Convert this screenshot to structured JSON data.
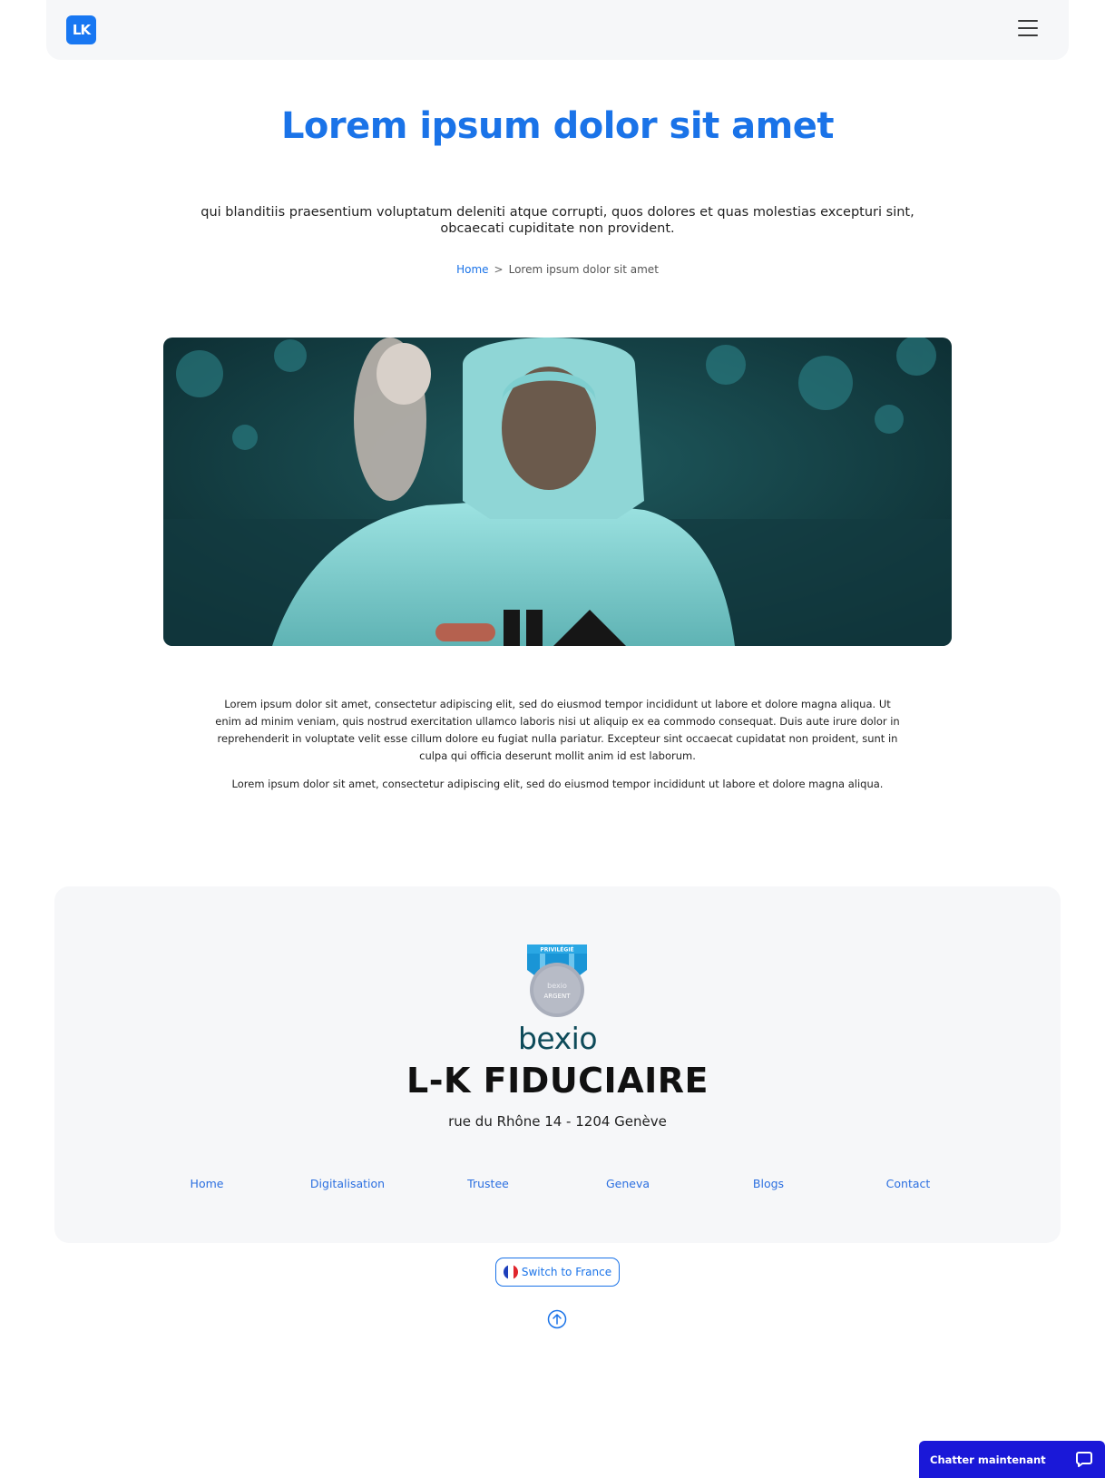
{
  "header": {
    "logo_text": "LK",
    "menu_icon": "hamburger-menu-icon"
  },
  "hero": {
    "title": "Lorem ipsum dolor sit amet",
    "subtitle": "qui blanditiis praesentium voluptatum deleniti atque corrupti, quos dolores et quas molestias excepturi sint, obcaecati cupiditate non provident."
  },
  "breadcrumb": {
    "home": "Home",
    "separator": ">",
    "current": "Lorem ipsum dolor sit amet"
  },
  "content": {
    "paragraph_1": "Lorem ipsum dolor sit amet, consectetur adipiscing elit, sed do eiusmod tempor incididunt ut labore et dolore magna aliqua. Ut enim ad minim veniam, quis nostrud exercitation ullamco laboris nisi ut aliquip ex ea commodo consequat. Duis aute irure dolor in reprehenderit in voluptate velit esse cillum dolore eu fugiat nulla pariatur. Excepteur sint occaecat cupidatat non proident, sunt in culpa qui officia deserunt mollit anim id est laborum.",
    "paragraph_2": "Lorem ipsum dolor sit amet, consectetur adipiscing elit, sed do eiusmod tempor incididunt ut labore et dolore magna aliqua."
  },
  "footer": {
    "badge": {
      "ribbon": "PRIVILÉGIÉ",
      "brand": "bexio",
      "level": "ARGENT"
    },
    "partner_logo": "bexio",
    "company": "L-K FIDUCIAIRE",
    "address": "rue du Rhône 14 - 1204 Genève",
    "nav": [
      "Home",
      "Digitalisation",
      "Trustee",
      "Geneva",
      "Blogs",
      "Contact"
    ],
    "switch_label": "Switch to France",
    "back_to_top_icon": "arrow-up-circle-icon"
  },
  "chat": {
    "label": "Chatter maintenant",
    "icon": "chat-bubble-icon",
    "color": "#1a18d8"
  },
  "colors": {
    "accent": "#1a73e8",
    "footer_bg": "#f6f7f9",
    "bexio_teal": "#0e4b5a"
  }
}
